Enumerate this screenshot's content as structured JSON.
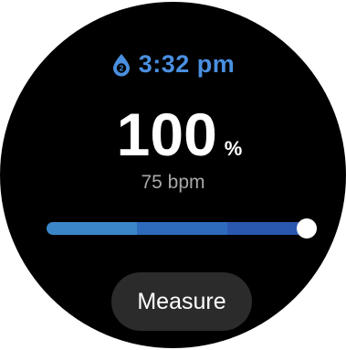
{
  "header": {
    "icon": "blood-oxygen-drop-icon",
    "icon_badge": "2",
    "time": "3:32 pm"
  },
  "reading": {
    "value": "100",
    "unit": "%",
    "heart_rate": "75 bpm"
  },
  "level_bar": {
    "level_percent": 100,
    "colors": [
      "#3b86c8",
      "#2e6bbd",
      "#2a58b0"
    ]
  },
  "actions": {
    "measure_label": "Measure"
  },
  "colors": {
    "accent": "#4a8fe0",
    "background": "#000000",
    "button": "#2b2b2b"
  }
}
